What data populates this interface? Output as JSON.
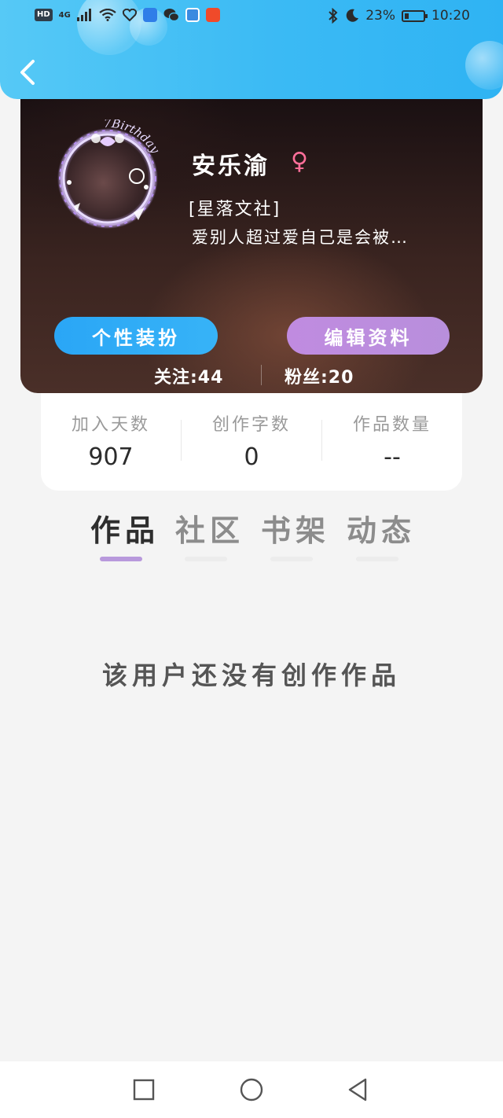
{
  "status_bar": {
    "hd": "HD",
    "network": "4G",
    "bluetooth_icon": "bluetooth-icon",
    "moon_icon": "moon-icon",
    "battery_percent": "23%",
    "battery_level": 0.23,
    "time": "10:20"
  },
  "header": {
    "back_icon": "chevron-left-icon"
  },
  "profile": {
    "name": "安乐渝",
    "gender_symbol": "♀",
    "club": "[星落文社]",
    "bio": "爱别人超过爱自己是会被…",
    "avatar_frame_text": "7Birthday",
    "buttons": {
      "outfit": "个性装扮",
      "edit": "编辑资料"
    },
    "following": "关注:44",
    "followers": "粉丝:20"
  },
  "stats": [
    {
      "label": "加入天数",
      "value": "907"
    },
    {
      "label": "创作字数",
      "value": "0"
    },
    {
      "label": "作品数量",
      "value": "--"
    }
  ],
  "tabs": [
    {
      "label": "作品",
      "active": true
    },
    {
      "label": "社区",
      "active": false
    },
    {
      "label": "书架",
      "active": false
    },
    {
      "label": "动态",
      "active": false
    }
  ],
  "empty_message": "该用户还没有创作作品",
  "nav_bar": {
    "recent_icon": "square-icon",
    "home_icon": "circle-icon",
    "back_icon": "triangle-back-icon"
  },
  "colors": {
    "header_blue": "#3bbaf4",
    "outfit_button": "#2aa6f6",
    "edit_button": "#c08be0",
    "active_tab_indicator": "#b899dc",
    "gender_pink": "#ff6f9a"
  }
}
